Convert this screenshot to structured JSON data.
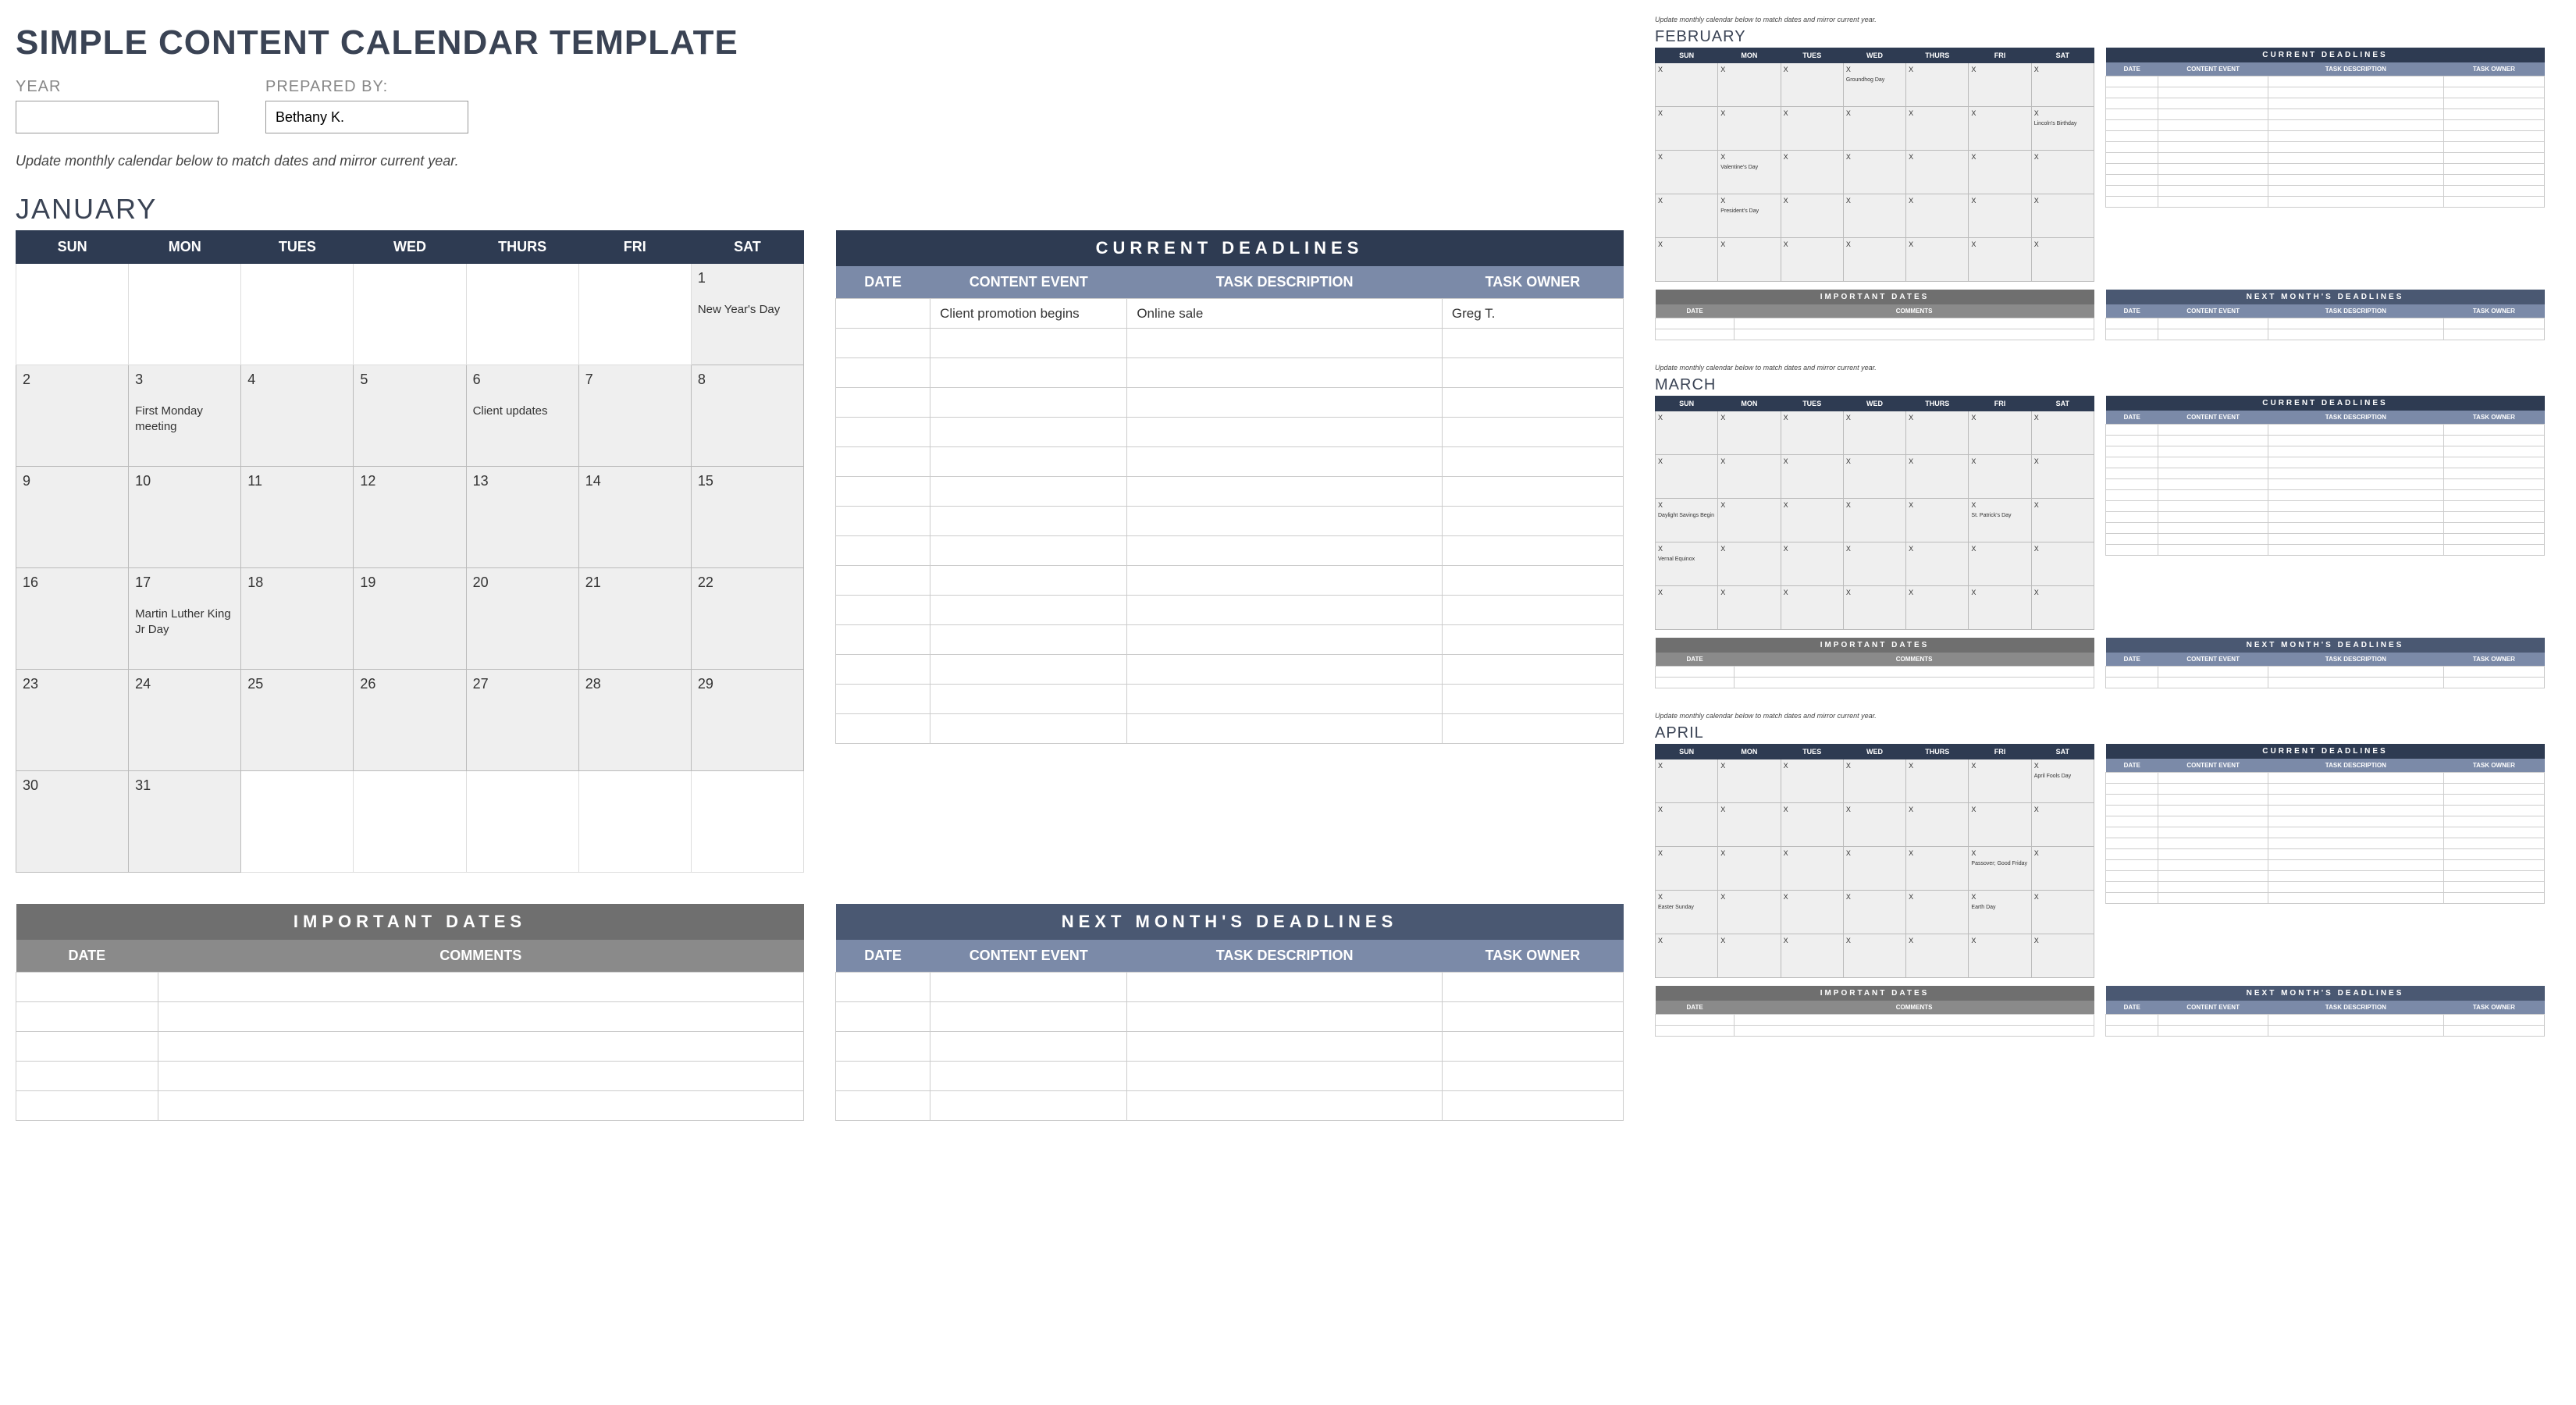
{
  "title": "SIMPLE CONTENT CALENDAR TEMPLATE",
  "meta": {
    "year_label": "YEAR",
    "year_value": "",
    "prepared_label": "PREPARED BY:",
    "prepared_value": "Bethany K."
  },
  "instruction": "Update monthly calendar below to match dates and mirror current year.",
  "day_headers": [
    "SUN",
    "MON",
    "TUES",
    "WED",
    "THURS",
    "FRI",
    "SAT"
  ],
  "deadlines_headers": [
    "DATE",
    "CONTENT EVENT",
    "TASK DESCRIPTION",
    "TASK OWNER"
  ],
  "deadlines_title": "CURRENT  DEADLINES",
  "next_deadlines_title": "NEXT  MONTH'S  DEADLINES",
  "important_title": "IMPORTANT  DATES",
  "important_headers": [
    "DATE",
    "COMMENTS"
  ],
  "main_month": {
    "name": "JANUARY",
    "weeks": [
      [
        null,
        null,
        null,
        null,
        null,
        null,
        {
          "d": 1,
          "e": "New Year's Day"
        }
      ],
      [
        {
          "d": 2
        },
        {
          "d": 3,
          "e": "First Monday meeting"
        },
        {
          "d": 4
        },
        {
          "d": 5
        },
        {
          "d": 6,
          "e": "Client updates"
        },
        {
          "d": 7
        },
        {
          "d": 8
        }
      ],
      [
        {
          "d": 9
        },
        {
          "d": 10
        },
        {
          "d": 11
        },
        {
          "d": 12
        },
        {
          "d": 13
        },
        {
          "d": 14
        },
        {
          "d": 15
        }
      ],
      [
        {
          "d": 16
        },
        {
          "d": 17,
          "e": "Martin Luther King Jr Day"
        },
        {
          "d": 18
        },
        {
          "d": 19
        },
        {
          "d": 20
        },
        {
          "d": 21
        },
        {
          "d": 22
        }
      ],
      [
        {
          "d": 23
        },
        {
          "d": 24
        },
        {
          "d": 25
        },
        {
          "d": 26
        },
        {
          "d": 27
        },
        {
          "d": 28
        },
        {
          "d": 29
        }
      ],
      [
        {
          "d": 30
        },
        {
          "d": 31
        },
        null,
        null,
        null,
        null,
        null
      ]
    ],
    "deadlines": [
      {
        "date": "",
        "event": "Client promotion begins",
        "desc": "Online sale",
        "owner": "Greg T."
      },
      {
        "date": "",
        "event": "",
        "desc": "",
        "owner": ""
      },
      {
        "date": "",
        "event": "",
        "desc": "",
        "owner": ""
      },
      {
        "date": "",
        "event": "",
        "desc": "",
        "owner": ""
      },
      {
        "date": "",
        "event": "",
        "desc": "",
        "owner": ""
      },
      {
        "date": "",
        "event": "",
        "desc": "",
        "owner": ""
      },
      {
        "date": "",
        "event": "",
        "desc": "",
        "owner": ""
      },
      {
        "date": "",
        "event": "",
        "desc": "",
        "owner": ""
      },
      {
        "date": "",
        "event": "",
        "desc": "",
        "owner": ""
      },
      {
        "date": "",
        "event": "",
        "desc": "",
        "owner": ""
      },
      {
        "date": "",
        "event": "",
        "desc": "",
        "owner": ""
      },
      {
        "date": "",
        "event": "",
        "desc": "",
        "owner": ""
      },
      {
        "date": "",
        "event": "",
        "desc": "",
        "owner": ""
      },
      {
        "date": "",
        "event": "",
        "desc": "",
        "owner": ""
      },
      {
        "date": "",
        "event": "",
        "desc": "",
        "owner": ""
      }
    ],
    "important": [
      {
        "date": "",
        "comments": ""
      },
      {
        "date": "",
        "comments": ""
      },
      {
        "date": "",
        "comments": ""
      },
      {
        "date": "",
        "comments": ""
      },
      {
        "date": "",
        "comments": ""
      }
    ],
    "next_deadlines": [
      {
        "date": "",
        "event": "",
        "desc": "",
        "owner": ""
      },
      {
        "date": "",
        "event": "",
        "desc": "",
        "owner": ""
      },
      {
        "date": "",
        "event": "",
        "desc": "",
        "owner": ""
      },
      {
        "date": "",
        "event": "",
        "desc": "",
        "owner": ""
      },
      {
        "date": "",
        "event": "",
        "desc": "",
        "owner": ""
      }
    ]
  },
  "mini_months": [
    {
      "name": "FEBRUARY",
      "weeks": [
        [
          {
            "d": "X"
          },
          {
            "d": "X"
          },
          {
            "d": "X"
          },
          {
            "d": "X",
            "e": "Groundhog Day"
          },
          {
            "d": "X"
          },
          {
            "d": "X"
          },
          {
            "d": "X"
          }
        ],
        [
          {
            "d": "X"
          },
          {
            "d": "X"
          },
          {
            "d": "X"
          },
          {
            "d": "X"
          },
          {
            "d": "X"
          },
          {
            "d": "X"
          },
          {
            "d": "X",
            "e": "Lincoln's Birthday"
          }
        ],
        [
          {
            "d": "X"
          },
          {
            "d": "X",
            "e": "Valentine's Day"
          },
          {
            "d": "X"
          },
          {
            "d": "X"
          },
          {
            "d": "X"
          },
          {
            "d": "X"
          },
          {
            "d": "X"
          }
        ],
        [
          {
            "d": "X"
          },
          {
            "d": "X",
            "e": "President's Day"
          },
          {
            "d": "X"
          },
          {
            "d": "X"
          },
          {
            "d": "X"
          },
          {
            "d": "X"
          },
          {
            "d": "X"
          }
        ],
        [
          {
            "d": "X"
          },
          {
            "d": "X"
          },
          {
            "d": "X"
          },
          {
            "d": "X"
          },
          {
            "d": "X"
          },
          {
            "d": "X"
          },
          {
            "d": "X"
          }
        ]
      ]
    },
    {
      "name": "MARCH",
      "weeks": [
        [
          {
            "d": "X"
          },
          {
            "d": "X"
          },
          {
            "d": "X"
          },
          {
            "d": "X"
          },
          {
            "d": "X"
          },
          {
            "d": "X"
          },
          {
            "d": "X"
          }
        ],
        [
          {
            "d": "X"
          },
          {
            "d": "X"
          },
          {
            "d": "X"
          },
          {
            "d": "X"
          },
          {
            "d": "X"
          },
          {
            "d": "X"
          },
          {
            "d": "X"
          }
        ],
        [
          {
            "d": "X",
            "e": "Daylight Savings Begin"
          },
          {
            "d": "X"
          },
          {
            "d": "X"
          },
          {
            "d": "X"
          },
          {
            "d": "X"
          },
          {
            "d": "X",
            "e": "St. Patrick's Day"
          },
          {
            "d": "X"
          }
        ],
        [
          {
            "d": "X",
            "e": "Vernal Equinox"
          },
          {
            "d": "X"
          },
          {
            "d": "X"
          },
          {
            "d": "X"
          },
          {
            "d": "X"
          },
          {
            "d": "X"
          },
          {
            "d": "X"
          }
        ],
        [
          {
            "d": "X"
          },
          {
            "d": "X"
          },
          {
            "d": "X"
          },
          {
            "d": "X"
          },
          {
            "d": "X"
          },
          {
            "d": "X"
          },
          {
            "d": "X"
          }
        ]
      ]
    },
    {
      "name": "APRIL",
      "weeks": [
        [
          {
            "d": "X"
          },
          {
            "d": "X"
          },
          {
            "d": "X"
          },
          {
            "d": "X"
          },
          {
            "d": "X"
          },
          {
            "d": "X"
          },
          {
            "d": "X",
            "e": "April Fools Day"
          }
        ],
        [
          {
            "d": "X"
          },
          {
            "d": "X"
          },
          {
            "d": "X"
          },
          {
            "d": "X"
          },
          {
            "d": "X"
          },
          {
            "d": "X"
          },
          {
            "d": "X"
          }
        ],
        [
          {
            "d": "X"
          },
          {
            "d": "X"
          },
          {
            "d": "X"
          },
          {
            "d": "X"
          },
          {
            "d": "X"
          },
          {
            "d": "X",
            "e": "Passover; Good Friday"
          },
          {
            "d": "X"
          }
        ],
        [
          {
            "d": "X",
            "e": "Easter Sunday"
          },
          {
            "d": "X"
          },
          {
            "d": "X"
          },
          {
            "d": "X"
          },
          {
            "d": "X"
          },
          {
            "d": "X",
            "e": "Earth Day"
          },
          {
            "d": "X"
          }
        ],
        [
          {
            "d": "X"
          },
          {
            "d": "X"
          },
          {
            "d": "X"
          },
          {
            "d": "X"
          },
          {
            "d": "X"
          },
          {
            "d": "X"
          },
          {
            "d": "X"
          }
        ]
      ]
    }
  ],
  "mini_empty_rows": 12,
  "mini_small_rows": 2
}
